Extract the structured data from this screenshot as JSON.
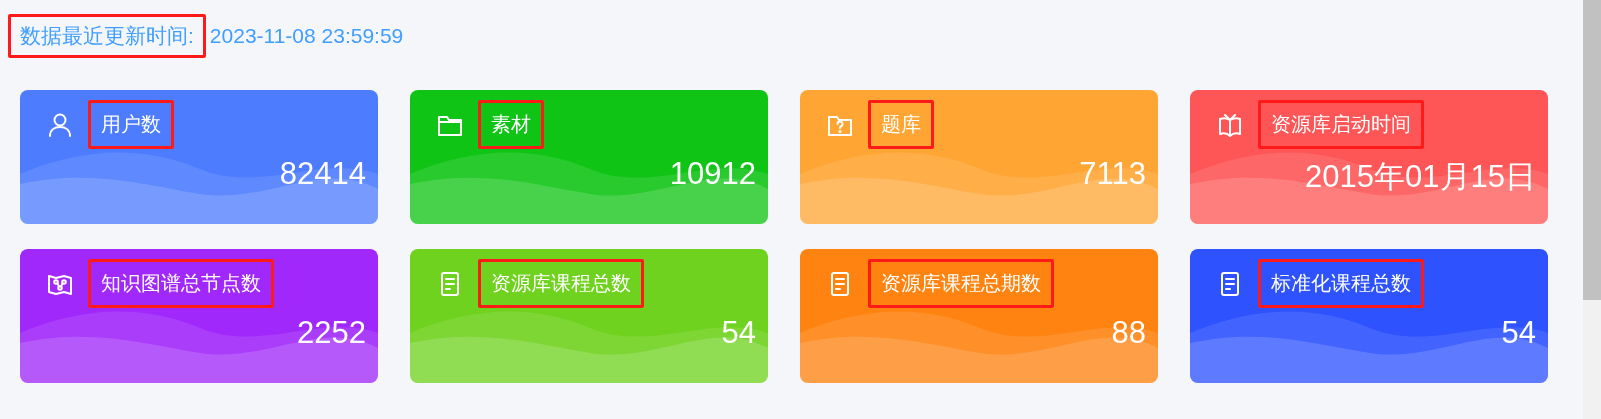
{
  "header": {
    "label": "数据最近更新时间:",
    "label_highlighted": true,
    "value": "2023-11-08 23:59:59"
  },
  "cards": [
    {
      "kind": "user",
      "label": "用户数",
      "value": "82414",
      "color": "#4d7cfe",
      "highlighted": true
    },
    {
      "kind": "folder",
      "label": "素材",
      "value": "10912",
      "color": "#10c416",
      "highlighted": true
    },
    {
      "kind": "question",
      "label": "题库",
      "value": "7113",
      "color": "#ffa534",
      "highlighted": true
    },
    {
      "kind": "book",
      "label": "资源库启动时间",
      "value": "2015年01月15日",
      "color": "#fe5656",
      "highlighted": true
    },
    {
      "kind": "map",
      "label": "知识图谱总节点数",
      "value": "2252",
      "color": "#a128fa",
      "highlighted": true
    },
    {
      "kind": "document",
      "label": "资源库课程总数",
      "value": "54",
      "color": "#6fd21e",
      "highlighted": true
    },
    {
      "kind": "document",
      "label": "资源库课程总期数",
      "value": "88",
      "color": "#fe8311",
      "highlighted": true
    },
    {
      "kind": "document",
      "label": "标准化课程总数",
      "value": "54",
      "color": "#2d52fe",
      "highlighted": true
    }
  ]
}
